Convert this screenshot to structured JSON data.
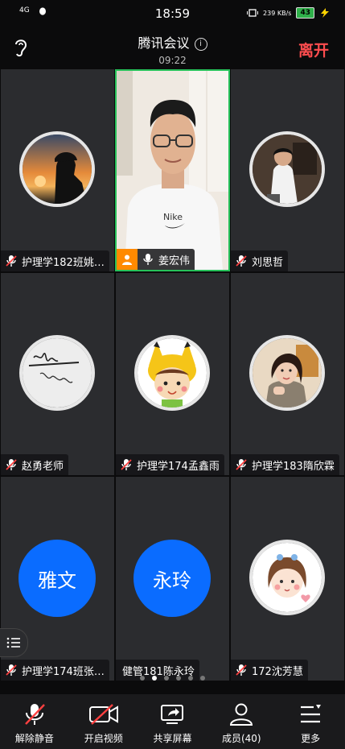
{
  "status_bar": {
    "network": "4G",
    "time": "18:59",
    "speed": "239 KB/s",
    "battery": "43"
  },
  "header": {
    "title": "腾讯会议",
    "timer": "09:22",
    "leave_label": "离开"
  },
  "participants": [
    {
      "name": "护理学182班姚…",
      "muted": true
    },
    {
      "name": "姜宏伟",
      "muted": false,
      "host": true,
      "video_on": true
    },
    {
      "name": "刘思哲",
      "muted": true
    },
    {
      "name": "赵勇老师",
      "muted": true
    },
    {
      "name": "护理学174孟鑫雨",
      "muted": true
    },
    {
      "name": "护理学183隋欣霖",
      "muted": true
    },
    {
      "name": "护理学174班张…",
      "muted": true,
      "avatar_text": "雅文",
      "avatar_color": "#0a6cff"
    },
    {
      "name": "健管181陈永玲",
      "muted": false,
      "avatar_text": "永玲",
      "avatar_color": "#0a6cff"
    },
    {
      "name": "172沈芳慧",
      "muted": true
    }
  ],
  "pagination": {
    "total_pages": 6,
    "current_page": 2
  },
  "toolbar": {
    "unmute": "解除静音",
    "start_video": "开启视频",
    "share_screen": "共享屏幕",
    "members": "成员(40)",
    "more": "更多"
  }
}
